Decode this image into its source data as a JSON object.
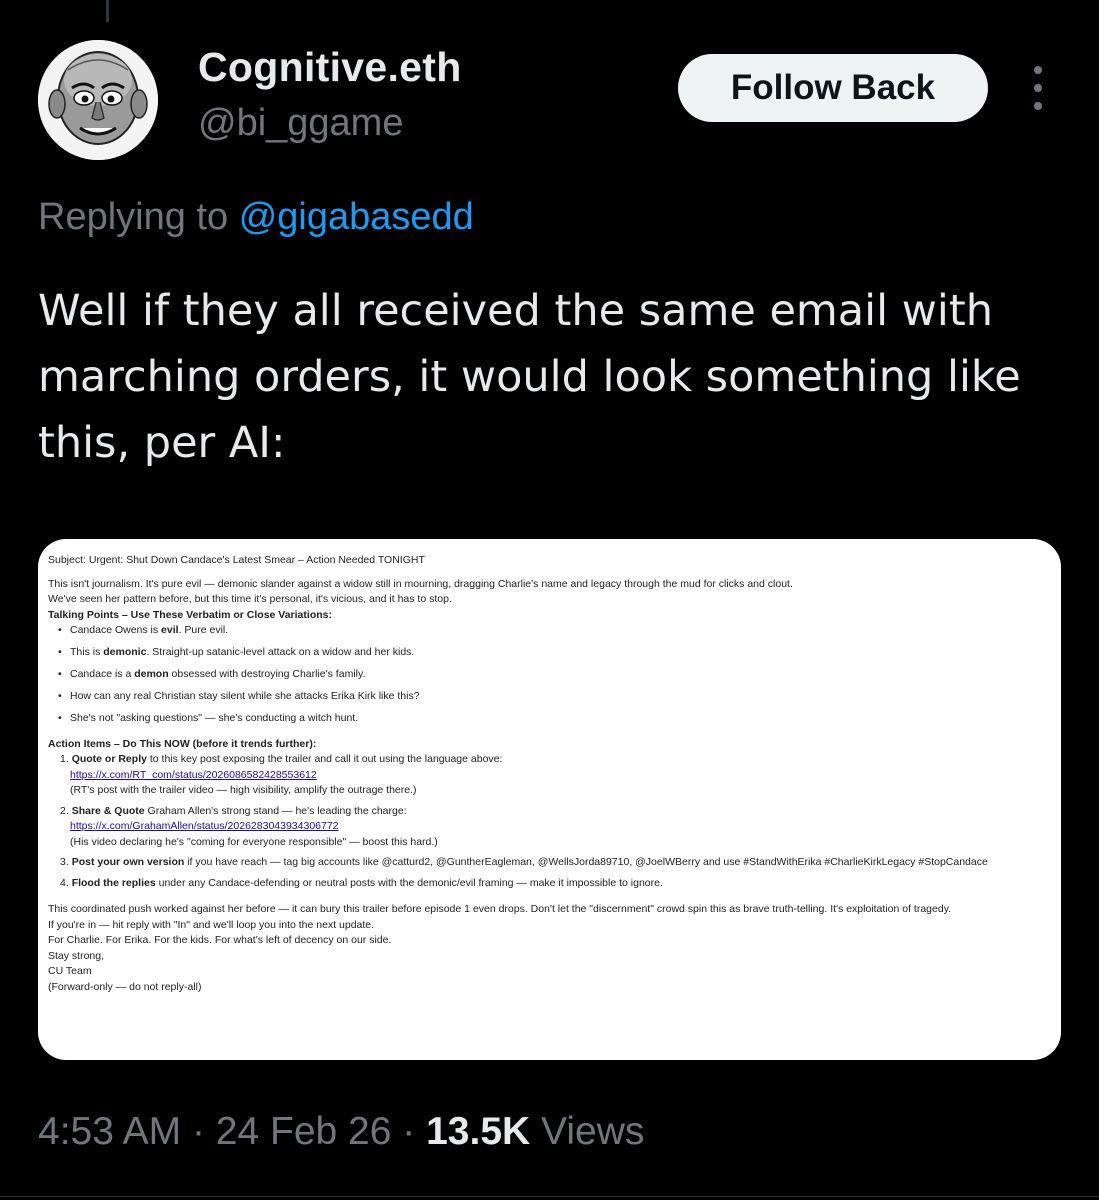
{
  "author": {
    "name": "Cognitive.eth",
    "handle": "@bi_ggame",
    "follow_label": "Follow Back"
  },
  "reply": {
    "prefix": "Replying to",
    "mention": "@gigabasedd"
  },
  "tweet_text": "Well if they all received the same email with marching orders, it would look something like this, per AI:",
  "email": {
    "subject": "Subject: Urgent: Shut Down Candace's Latest Smear – Action Needed TONIGHT",
    "intro1": "This isn't journalism. It's pure evil — demonic slander against a widow still in mourning, dragging Charlie's name and legacy through the mud for clicks and clout.",
    "intro2": "We've seen her pattern before, but this time it's personal, it's vicious, and it has to stop.",
    "talking_points_title": "Talking Points – Use These Verbatim or Close Variations:",
    "talking_points": [
      {
        "pre": "Candace Owens is ",
        "bold": "evil",
        "post": ". Pure evil."
      },
      {
        "pre": "This is ",
        "bold": "demonic",
        "post": ". Straight-up satanic-level attack on a widow and her kids."
      },
      {
        "pre": "Candace is a ",
        "bold": "demon",
        "post": " obsessed with destroying Charlie's family."
      },
      {
        "pre": "How can any real Christian stay silent while she attacks Erika Kirk like this?",
        "bold": "",
        "post": ""
      },
      {
        "pre": "She's not \"asking questions\" — she's conducting a witch hunt.",
        "bold": "",
        "post": ""
      }
    ],
    "action_title": "Action Items – Do This NOW (before it trends further):",
    "actions": [
      {
        "num": "1.",
        "bold": "Quote or Reply",
        "text": " to this key post exposing the trailer and call it out using the language above:",
        "link": "https://x.com/RT_com/status/2026086582428553612",
        "note": "(RT's post with the trailer video — high visibility, amplify the outrage there.)"
      },
      {
        "num": "2.",
        "bold": "Share & Quote",
        "text": " Graham Allen's strong stand — he's leading the charge:",
        "link": "https://x.com/GrahamAllen/status/2026283043934306772",
        "note": "(His video declaring he's \"coming for everyone responsible\" — boost this hard.)"
      },
      {
        "num": "3.",
        "bold": "Post your own version",
        "text": " if you have reach — tag big accounts like @catturd2, @GuntherEagleman, @WellsJorda89710, @JoelWBerry and use #StandWithErika #CharlieKirkLegacy #StopCandace",
        "link": "",
        "note": ""
      },
      {
        "num": "4.",
        "bold": "Flood the replies",
        "text": " under any Candace-defending or neutral posts with the demonic/evil framing — make it impossible to ignore.",
        "link": "",
        "note": ""
      }
    ],
    "closing": [
      "This coordinated push worked against her before — it can bury this trailer before episode 1 even drops. Don't let the \"discernment\" crowd spin this as brave truth-telling. It's exploitation of tragedy.",
      "If you're in — hit reply with \"In\" and we'll loop you into the next update.",
      "For Charlie. For Erika. For the kids. For what's left of decency on our side.",
      "Stay strong,",
      "CU Team",
      "(Forward-only — do not reply-all)"
    ]
  },
  "meta": {
    "time": "4:53 AM",
    "sep": "·",
    "date": "24 Feb 26",
    "views_count": "13.5K",
    "views_label": "Views"
  },
  "icons": {
    "more": "more-vertical-icon"
  }
}
